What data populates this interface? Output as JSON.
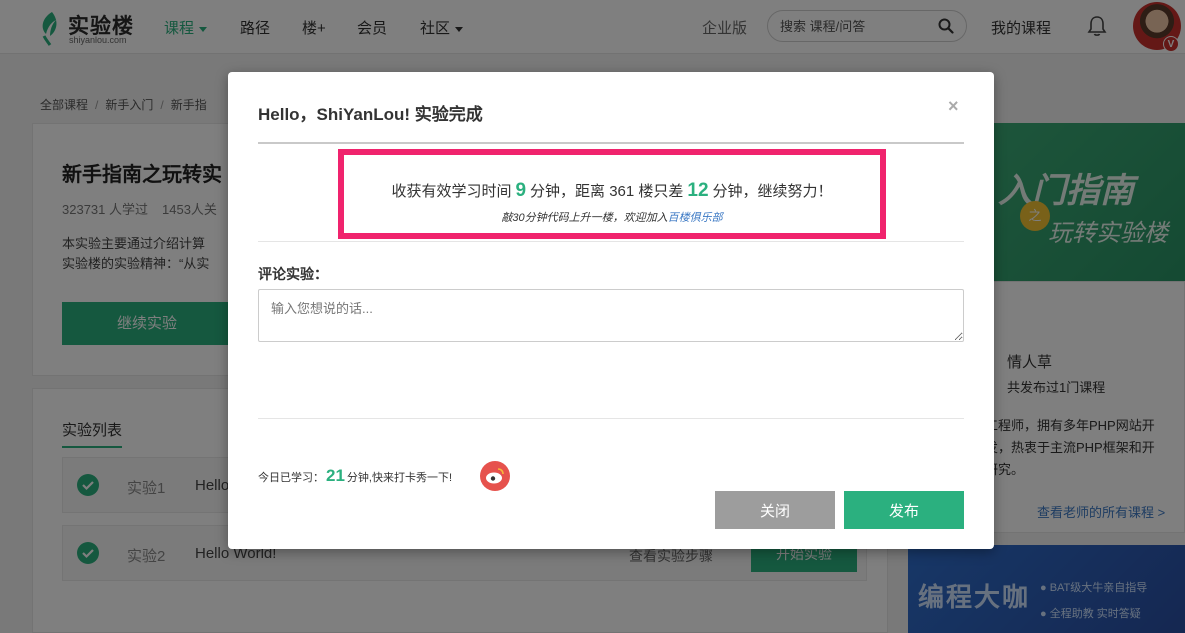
{
  "header": {
    "logo_text": "实验楼",
    "logo_sub": "shiyanlou.com",
    "nav": [
      {
        "label": "课程",
        "active": true,
        "dropdown": true
      },
      {
        "label": "路径",
        "active": false,
        "dropdown": false
      },
      {
        "label": "楼+",
        "active": false,
        "dropdown": false
      },
      {
        "label": "会员",
        "active": false,
        "dropdown": false
      },
      {
        "label": "社区",
        "active": false,
        "dropdown": true
      }
    ],
    "enterprise": "企业版",
    "search_placeholder": "搜索 课程/问答",
    "my_courses": "我的课程",
    "vip_badge": "V",
    "accent": "#2bb07f"
  },
  "breadcrumb": [
    "全部课程",
    "新手入门",
    "新手指"
  ],
  "course": {
    "title": "新手指南之玩转实",
    "learners": "323731 人学过",
    "followers": "1453人关",
    "desc_line1": "本实验主要通过介绍计算",
    "desc_line2": "实验楼的实验精神：“从实",
    "continue_label": "继续实验"
  },
  "labs": {
    "title": "实验列表",
    "rows": [
      {
        "num": "实验1",
        "name": "Hello",
        "steps": "",
        "start": ""
      },
      {
        "num": "实验2",
        "name": "Hello World!",
        "steps": "查看实验步骤",
        "start": "开始实验"
      }
    ]
  },
  "sidebar": {
    "banner_line1": "入门指南",
    "banner_dot": "之",
    "banner_line2": "玩转实验楼",
    "teacher_name": "情人草",
    "teacher_count": "共发布过1门课程",
    "teacher_bio_1": "工程师，拥有多年PHP网站开",
    "teacher_bio_2": "发，热衷于主流PHP框架和开",
    "teacher_bio_3": "研究。",
    "teacher_link": "查看老师的所有课程 >",
    "ad_title": "编程大咖",
    "ad_line1": "● BAT级大牛亲自指导",
    "ad_line2": "● 全程助教  实时答疑"
  },
  "modal": {
    "title": "Hello，ShiYanLou! 实验完成",
    "close_symbol": "×",
    "stat_prefix": "收获有效学习时间",
    "stat_minutes": "9",
    "stat_middle": "分钟，距离 361 楼只差",
    "stat_gap": "12",
    "stat_suffix": "分钟，继续努力！",
    "sub_text": "敲30分钟代码上升一楼，欢迎加入",
    "sub_link": "百楼俱乐部",
    "comment_label": "评论实验：",
    "comment_placeholder": "输入您想说的话...",
    "today_prefix": "今日已学习：",
    "today_minutes": "21",
    "today_suffix": "分钟,快来打卡秀一下!",
    "close_button": "关闭",
    "publish_button": "发布",
    "highlight_color": "#f0236d"
  }
}
